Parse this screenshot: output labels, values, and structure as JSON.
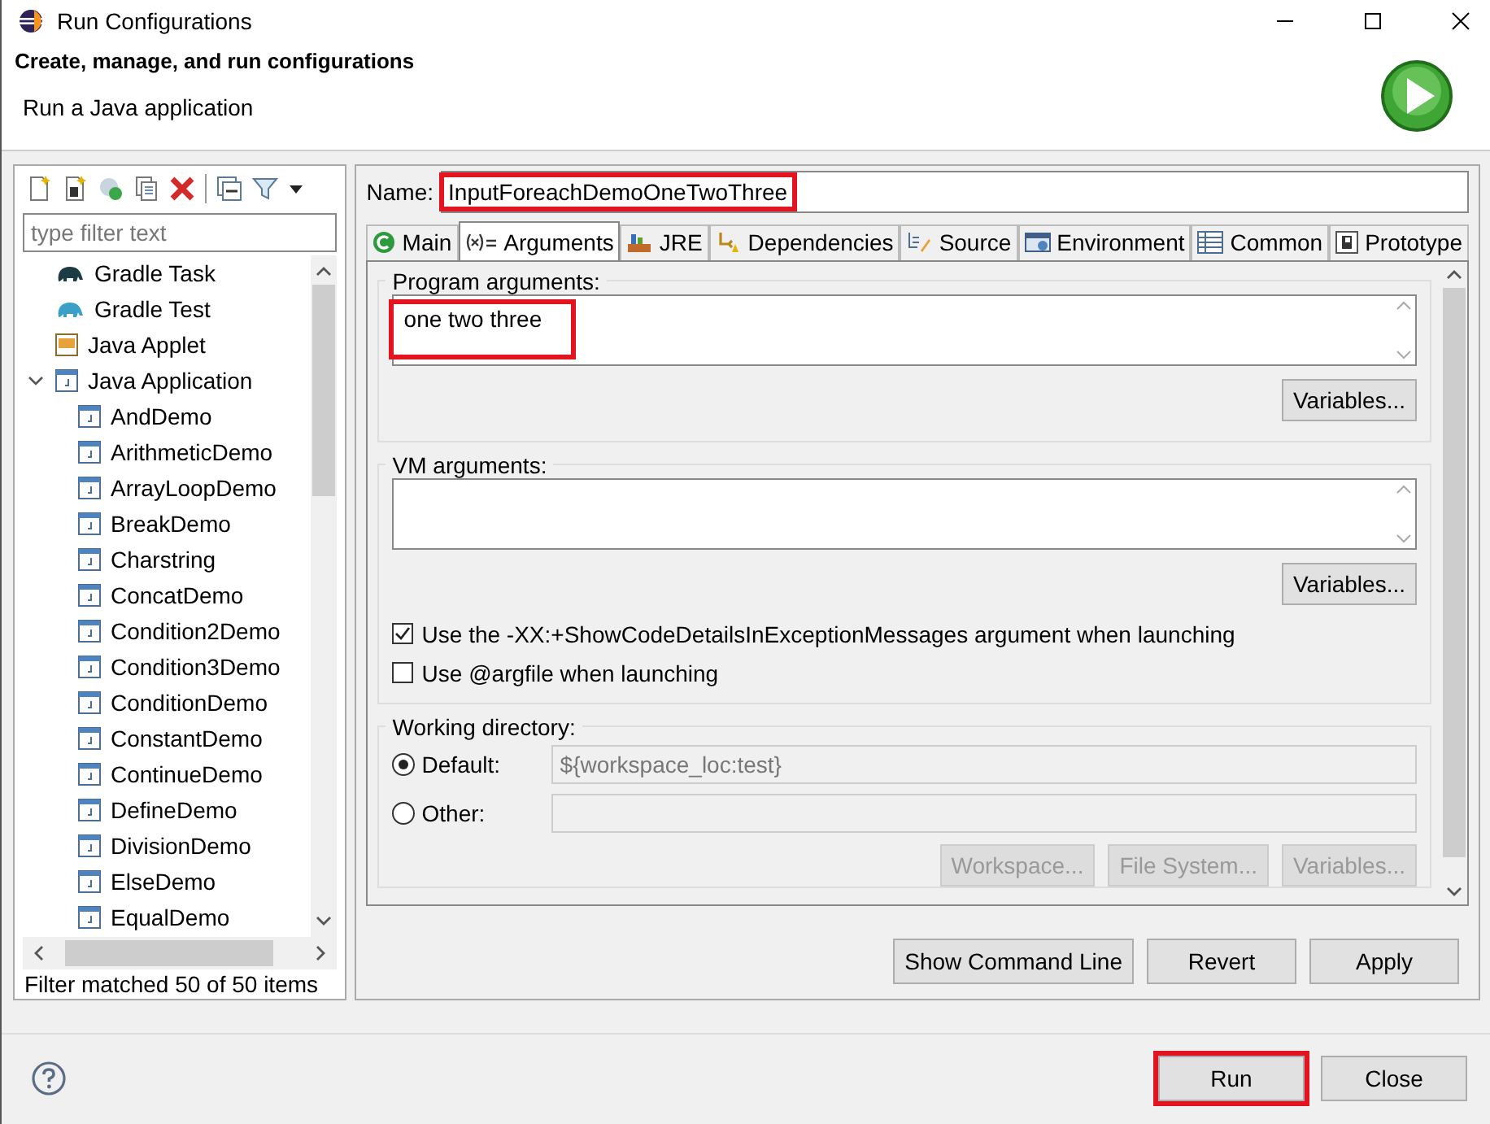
{
  "window": {
    "title": "Run Configurations"
  },
  "header": {
    "title": "Create, manage, and run configurations",
    "subtitle": "Run a Java application"
  },
  "filter": {
    "placeholder": "type filter text"
  },
  "tree": [
    {
      "label": "Gradle Task",
      "kind": "gradle-task"
    },
    {
      "label": "Gradle Test",
      "kind": "gradle-test"
    },
    {
      "label": "Java Applet",
      "kind": "applet"
    },
    {
      "label": "Java Application",
      "kind": "application",
      "expanded": true,
      "children": [
        {
          "label": "AndDemo"
        },
        {
          "label": "ArithmeticDemo"
        },
        {
          "label": "ArrayLoopDemo"
        },
        {
          "label": "BreakDemo"
        },
        {
          "label": "Charstring"
        },
        {
          "label": "ConcatDemo"
        },
        {
          "label": "Condition2Demo"
        },
        {
          "label": "Condition3Demo"
        },
        {
          "label": "ConditionDemo"
        },
        {
          "label": "ConstantDemo"
        },
        {
          "label": "ContinueDemo"
        },
        {
          "label": "DefineDemo"
        },
        {
          "label": "DivisionDemo"
        },
        {
          "label": "ElseDemo"
        },
        {
          "label": "EqualDemo"
        }
      ]
    }
  ],
  "filter_status": "Filter matched 50 of 50 items",
  "name": {
    "label": "Name:",
    "value": "InputForeachDemoOneTwoThree",
    "highlighted": true
  },
  "tabs": [
    {
      "label": "Main",
      "kind": "main",
      "selected": false
    },
    {
      "label": "Arguments",
      "kind": "arguments",
      "selected": true
    },
    {
      "label": "JRE",
      "kind": "jre",
      "selected": false
    },
    {
      "label": "Dependencies",
      "kind": "dependencies",
      "selected": false
    },
    {
      "label": "Source",
      "kind": "source",
      "selected": false
    },
    {
      "label": "Environment",
      "kind": "environment",
      "selected": false
    },
    {
      "label": "Common",
      "kind": "common",
      "selected": false
    },
    {
      "label": "Prototype",
      "kind": "prototype",
      "selected": false
    }
  ],
  "program_arguments": {
    "label": "Program arguments:",
    "value": "one two three",
    "highlighted": true,
    "button": "Variables..."
  },
  "vm_arguments": {
    "label": "VM arguments:",
    "button": "Variables..."
  },
  "options": [
    {
      "label": "Use the -XX:+ShowCodeDetailsInExceptionMessages argument when launching",
      "checked": true
    },
    {
      "label": "Use @argfile when launching",
      "checked": false
    }
  ],
  "working_directory": {
    "label": "Working directory:",
    "choices": [
      {
        "label": "Default:",
        "selected": true,
        "value": "${workspace_loc:test}"
      },
      {
        "label": "Other:",
        "selected": false
      }
    ],
    "buttons": [
      {
        "label": "Workspace...",
        "disabled": true
      },
      {
        "label": "File System...",
        "disabled": true
      },
      {
        "label": "Variables...",
        "disabled": true
      }
    ]
  },
  "config_buttons": [
    "Show Command Line",
    "Revert",
    "Apply"
  ],
  "dialog_buttons": [
    {
      "label": "Run",
      "highlighted": true
    },
    {
      "label": "Close",
      "highlighted": false
    }
  ]
}
